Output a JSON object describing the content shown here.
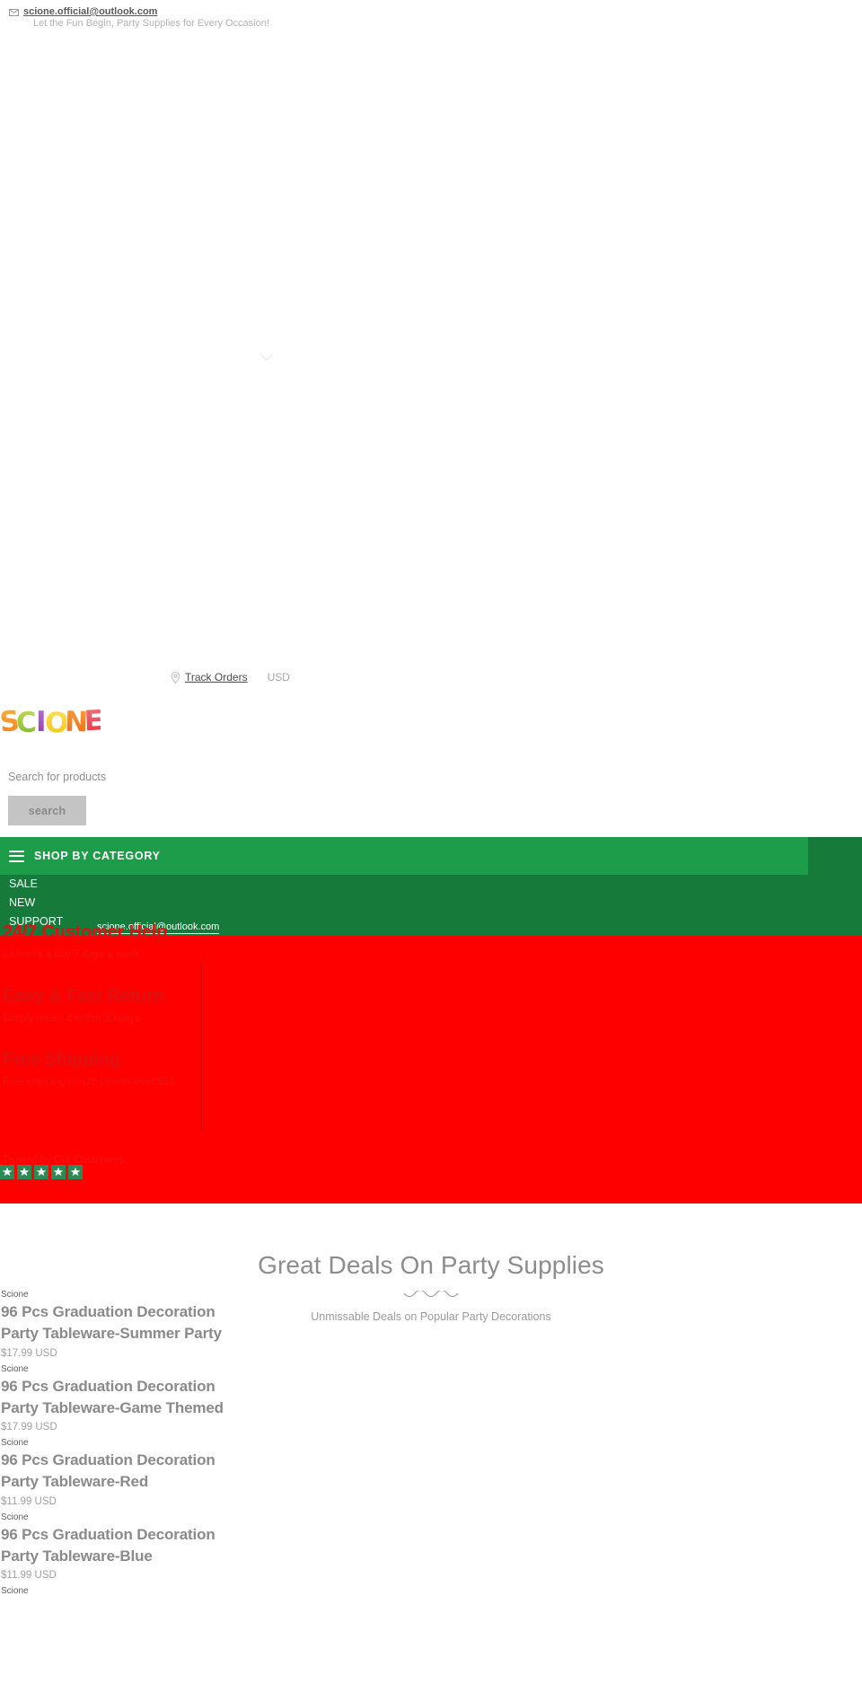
{
  "announcement": {
    "email": "scione.official@outlook.com",
    "email_icon": "envelope-icon",
    "tagline": "Let the Fun Begin, Party Supplies for Every Occasion!"
  },
  "utility": {
    "track_orders": "Track Orders",
    "track_icon": "map-pin-icon",
    "currency": "USD",
    "chevron_icon": "chevron-down-icon"
  },
  "logo": {
    "text": "SCIONE",
    "letters": [
      "S",
      "C",
      "I",
      "O",
      "N",
      "E"
    ],
    "colors": [
      "#F59A1E",
      "#8CC63F",
      "#A347C4",
      "#F5D820",
      "#EF7C1B",
      "#EE3E52"
    ]
  },
  "search": {
    "placeholder": "Search for products",
    "button_label": "search"
  },
  "nav": {
    "category_label": "SHOP BY CATEGORY",
    "menu_icon": "hamburger-icon",
    "items": [
      {
        "label": "SALE"
      },
      {
        "label": "NEW"
      },
      {
        "label": "SUPPORT"
      }
    ],
    "email": "scione.official@outlook.com",
    "bar_color": "#1D9C49",
    "block_color": "#157A3A"
  },
  "benefits": {
    "background": "#FF0000",
    "items": [
      {
        "title": "24/7 Customer Help",
        "subtitle": "24 hours a day 7 days a week"
      },
      {
        "title": "Easy & Fast Return",
        "subtitle": "Simply return it within 30 days"
      },
      {
        "title": "Free Shipping",
        "subtitle": "Free shipping on US Orders over $50"
      }
    ],
    "trusted_label": "Trusted by Our Customers",
    "star_count": 5,
    "star_color": "#2D8A55"
  },
  "deals": {
    "title": "Great Deals On Party Supplies",
    "divider_icon": "wave-divider",
    "subtitle": "Unmissable Deals on Popular Party Decorations"
  },
  "products": [
    {
      "brand": "Scione",
      "title": "96 Pcs Graduation Decoration Party Tableware-Summer Party",
      "price": "$17.99 USD"
    },
    {
      "brand": "Scione",
      "title": "96 Pcs Graduation Decoration Party Tableware-Game Themed",
      "price": "$17.99 USD"
    },
    {
      "brand": "Scione",
      "title": "96 Pcs Graduation Decoration Party Tableware-Red",
      "price": "$11.99 USD"
    },
    {
      "brand": "Scione",
      "title": "96 Pcs Graduation Decoration Party Tableware-Blue",
      "price": "$11.99 USD"
    },
    {
      "brand": "Scione",
      "title": "",
      "price": ""
    }
  ]
}
